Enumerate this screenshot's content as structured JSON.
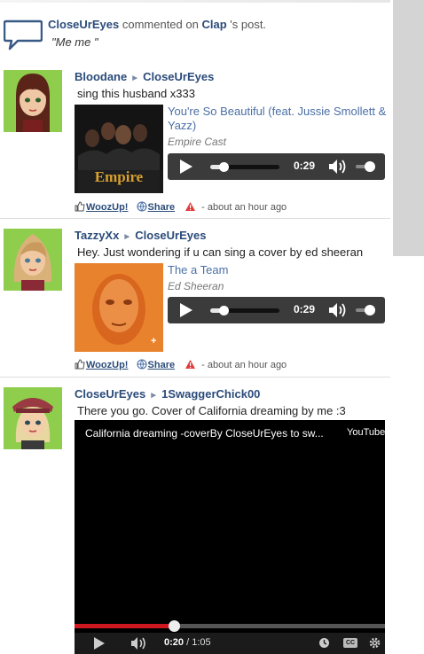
{
  "notification": {
    "user": "CloseUrEyes",
    "verb": "commented on",
    "target": "Clap",
    "suffix": "'s post.",
    "quote": "\"Me me \""
  },
  "posts": [
    {
      "author": "Bloodane",
      "recipient": "CloseUrEyes",
      "text": "sing this husband x333",
      "album_text": "Empire",
      "track_title": "You're So Beautiful (feat. Jussie Smollett & Yazz)",
      "track_artist": "Empire Cast",
      "time": "0:29",
      "woozup_label": "WoozUp!",
      "share_label": "Share",
      "timestamp": "- about an hour ago"
    },
    {
      "author": "TazzyXx",
      "recipient": "CloseUrEyes",
      "text": "Hey. Just wondering if u can sing a cover by ed sheeran",
      "album_text": "+",
      "track_title": "The a Team",
      "track_artist": "Ed Sheeran",
      "time": "0:29",
      "woozup_label": "WoozUp!",
      "share_label": "Share",
      "timestamp": "- about an hour ago"
    },
    {
      "author": "CloseUrEyes",
      "recipient": "1SwaggerChick00",
      "text": "There you go. Cover of California dreaming by me :3",
      "video": {
        "title": "California dreaming -coverBy CloseUrEyes to sw...",
        "source": "YouTube",
        "current_time": "0:20",
        "duration": "/ 1:05",
        "cc_label": "CC"
      }
    }
  ],
  "colors": {
    "link": "#2b4b7a",
    "track_link": "#4a6fa5",
    "avatar_bg": "#8fcd4d",
    "player_bg": "#3b3b3b",
    "video_progress": "#cc181e"
  },
  "icons": [
    "speech-bubble-icon",
    "thumbs-up-icon",
    "globe-icon",
    "warning-icon",
    "play-icon",
    "volume-icon",
    "clock-icon",
    "gear-icon"
  ]
}
